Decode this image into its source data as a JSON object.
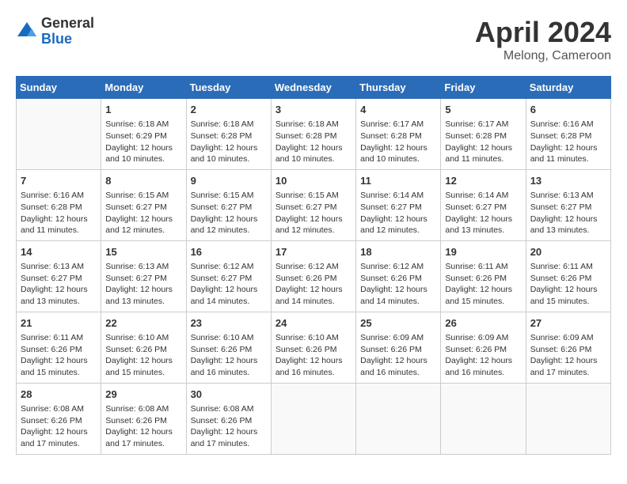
{
  "logo": {
    "general": "General",
    "blue": "Blue"
  },
  "title": "April 2024",
  "location": "Melong, Cameroon",
  "days_of_week": [
    "Sunday",
    "Monday",
    "Tuesday",
    "Wednesday",
    "Thursday",
    "Friday",
    "Saturday"
  ],
  "weeks": [
    [
      {
        "day": "",
        "info": ""
      },
      {
        "day": "1",
        "info": "Sunrise: 6:18 AM\nSunset: 6:29 PM\nDaylight: 12 hours\nand 10 minutes."
      },
      {
        "day": "2",
        "info": "Sunrise: 6:18 AM\nSunset: 6:28 PM\nDaylight: 12 hours\nand 10 minutes."
      },
      {
        "day": "3",
        "info": "Sunrise: 6:18 AM\nSunset: 6:28 PM\nDaylight: 12 hours\nand 10 minutes."
      },
      {
        "day": "4",
        "info": "Sunrise: 6:17 AM\nSunset: 6:28 PM\nDaylight: 12 hours\nand 10 minutes."
      },
      {
        "day": "5",
        "info": "Sunrise: 6:17 AM\nSunset: 6:28 PM\nDaylight: 12 hours\nand 11 minutes."
      },
      {
        "day": "6",
        "info": "Sunrise: 6:16 AM\nSunset: 6:28 PM\nDaylight: 12 hours\nand 11 minutes."
      }
    ],
    [
      {
        "day": "7",
        "info": "Sunrise: 6:16 AM\nSunset: 6:28 PM\nDaylight: 12 hours\nand 11 minutes."
      },
      {
        "day": "8",
        "info": "Sunrise: 6:15 AM\nSunset: 6:27 PM\nDaylight: 12 hours\nand 12 minutes."
      },
      {
        "day": "9",
        "info": "Sunrise: 6:15 AM\nSunset: 6:27 PM\nDaylight: 12 hours\nand 12 minutes."
      },
      {
        "day": "10",
        "info": "Sunrise: 6:15 AM\nSunset: 6:27 PM\nDaylight: 12 hours\nand 12 minutes."
      },
      {
        "day": "11",
        "info": "Sunrise: 6:14 AM\nSunset: 6:27 PM\nDaylight: 12 hours\nand 12 minutes."
      },
      {
        "day": "12",
        "info": "Sunrise: 6:14 AM\nSunset: 6:27 PM\nDaylight: 12 hours\nand 13 minutes."
      },
      {
        "day": "13",
        "info": "Sunrise: 6:13 AM\nSunset: 6:27 PM\nDaylight: 12 hours\nand 13 minutes."
      }
    ],
    [
      {
        "day": "14",
        "info": "Sunrise: 6:13 AM\nSunset: 6:27 PM\nDaylight: 12 hours\nand 13 minutes."
      },
      {
        "day": "15",
        "info": "Sunrise: 6:13 AM\nSunset: 6:27 PM\nDaylight: 12 hours\nand 13 minutes."
      },
      {
        "day": "16",
        "info": "Sunrise: 6:12 AM\nSunset: 6:27 PM\nDaylight: 12 hours\nand 14 minutes."
      },
      {
        "day": "17",
        "info": "Sunrise: 6:12 AM\nSunset: 6:26 PM\nDaylight: 12 hours\nand 14 minutes."
      },
      {
        "day": "18",
        "info": "Sunrise: 6:12 AM\nSunset: 6:26 PM\nDaylight: 12 hours\nand 14 minutes."
      },
      {
        "day": "19",
        "info": "Sunrise: 6:11 AM\nSunset: 6:26 PM\nDaylight: 12 hours\nand 15 minutes."
      },
      {
        "day": "20",
        "info": "Sunrise: 6:11 AM\nSunset: 6:26 PM\nDaylight: 12 hours\nand 15 minutes."
      }
    ],
    [
      {
        "day": "21",
        "info": "Sunrise: 6:11 AM\nSunset: 6:26 PM\nDaylight: 12 hours\nand 15 minutes."
      },
      {
        "day": "22",
        "info": "Sunrise: 6:10 AM\nSunset: 6:26 PM\nDaylight: 12 hours\nand 15 minutes."
      },
      {
        "day": "23",
        "info": "Sunrise: 6:10 AM\nSunset: 6:26 PM\nDaylight: 12 hours\nand 16 minutes."
      },
      {
        "day": "24",
        "info": "Sunrise: 6:10 AM\nSunset: 6:26 PM\nDaylight: 12 hours\nand 16 minutes."
      },
      {
        "day": "25",
        "info": "Sunrise: 6:09 AM\nSunset: 6:26 PM\nDaylight: 12 hours\nand 16 minutes."
      },
      {
        "day": "26",
        "info": "Sunrise: 6:09 AM\nSunset: 6:26 PM\nDaylight: 12 hours\nand 16 minutes."
      },
      {
        "day": "27",
        "info": "Sunrise: 6:09 AM\nSunset: 6:26 PM\nDaylight: 12 hours\nand 17 minutes."
      }
    ],
    [
      {
        "day": "28",
        "info": "Sunrise: 6:08 AM\nSunset: 6:26 PM\nDaylight: 12 hours\nand 17 minutes."
      },
      {
        "day": "29",
        "info": "Sunrise: 6:08 AM\nSunset: 6:26 PM\nDaylight: 12 hours\nand 17 minutes."
      },
      {
        "day": "30",
        "info": "Sunrise: 6:08 AM\nSunset: 6:26 PM\nDaylight: 12 hours\nand 17 minutes."
      },
      {
        "day": "",
        "info": ""
      },
      {
        "day": "",
        "info": ""
      },
      {
        "day": "",
        "info": ""
      },
      {
        "day": "",
        "info": ""
      }
    ]
  ]
}
